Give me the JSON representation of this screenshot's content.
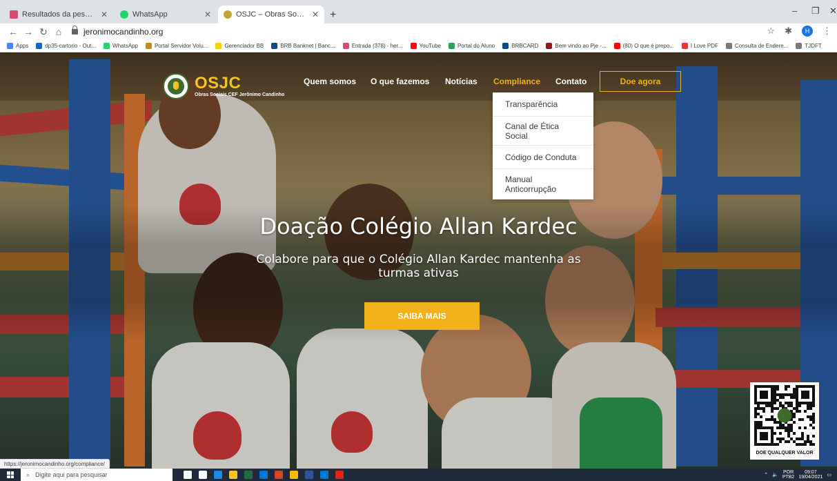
{
  "browser": {
    "tabs": [
      {
        "title": "Resultados da pesquisa - hernan",
        "color": "#d84b72"
      },
      {
        "title": "WhatsApp",
        "color": "#25d366"
      },
      {
        "title": "OSJC – Obras Sociais CEF Jerônim",
        "color": "#c5a331"
      }
    ],
    "new_tab_label": "+",
    "url": "jeronimocandinho.org",
    "profile_initial": "H",
    "window_controls": {
      "minimize": "–",
      "maximize": "❐",
      "close": "✕"
    },
    "bookmarks": [
      {
        "label": "Apps",
        "color": "#4285f4"
      },
      {
        "label": "dp35-cartorio - Out...",
        "color": "#1565c0"
      },
      {
        "label": "WhatsApp",
        "color": "#25d366"
      },
      {
        "label": "Portal Servidor Volu...",
        "color": "#c58b1a"
      },
      {
        "label": "Gerenciador BB",
        "color": "#f4d000"
      },
      {
        "label": "BRB Banknet | Banc...",
        "color": "#0b4a8b"
      },
      {
        "label": "Entrada (378) - her...",
        "color": "#d84b72"
      },
      {
        "label": "YouTube",
        "color": "#ff0000"
      },
      {
        "label": "Portal do Aluno",
        "color": "#2e9e5b"
      },
      {
        "label": "BRBCARD",
        "color": "#0b4a8b"
      },
      {
        "label": "Bem vindo ao Pje -...",
        "color": "#8a1c1c"
      },
      {
        "label": "(80) O que é prepo...",
        "color": "#ff0000"
      },
      {
        "label": "I Love PDF",
        "color": "#e53935"
      },
      {
        "label": "Consulta de Endere...",
        "color": "#7a7a7a"
      },
      {
        "label": "TJDFT",
        "color": "#7a7a7a"
      }
    ],
    "status_url": "https://jeronimocandinho.org/compliance/"
  },
  "site": {
    "logo_name": "OSJC",
    "logo_sub": "Obras Sociais CEF Jerônimo Candinho",
    "nav": [
      {
        "label": "Quem somos"
      },
      {
        "label": "O que fazemos"
      },
      {
        "label": "Notícias"
      },
      {
        "label": "Compliance",
        "active": true
      },
      {
        "label": "Contato"
      }
    ],
    "donate_label": "Doe agora",
    "compliance_menu": [
      "Transparência",
      "Canal de Ética Social",
      "Código de Conduta",
      "Manual Anticorrupção"
    ],
    "hero": {
      "title": "Doação Colégio Allan Kardec",
      "subtitle": "Colabore para que o Colégio Allan Kardec mantenha as turmas ativas",
      "cta": "SAIBA MAIS"
    },
    "qr_caption": "DOE QUALQUER VALOR",
    "colors": {
      "accent": "#f3b11b",
      "brand_green": "#3d6b2c"
    }
  },
  "taskbar": {
    "search_placeholder": "Digite aqui para pesquisar",
    "lang_top": "POR",
    "lang_bottom": "PTB2",
    "time": "09:07",
    "date": "19/04/2021",
    "apps": [
      {
        "name": "cortana-icon",
        "color": "#ffffff"
      },
      {
        "name": "task-view-icon",
        "color": "#ffffff"
      },
      {
        "name": "edge-icon",
        "color": "#1e88e5"
      },
      {
        "name": "file-explorer-icon",
        "color": "#f6c026"
      },
      {
        "name": "excel-icon",
        "color": "#1d6f42"
      },
      {
        "name": "store-icon",
        "color": "#0078d7"
      },
      {
        "name": "powerpoint-icon",
        "color": "#d24726"
      },
      {
        "name": "chrome-icon",
        "color": "#fbbc05"
      },
      {
        "name": "word-icon",
        "color": "#2b579a"
      },
      {
        "name": "mail-icon",
        "color": "#0078d7"
      },
      {
        "name": "acrobat-icon",
        "color": "#e2231a"
      }
    ]
  }
}
